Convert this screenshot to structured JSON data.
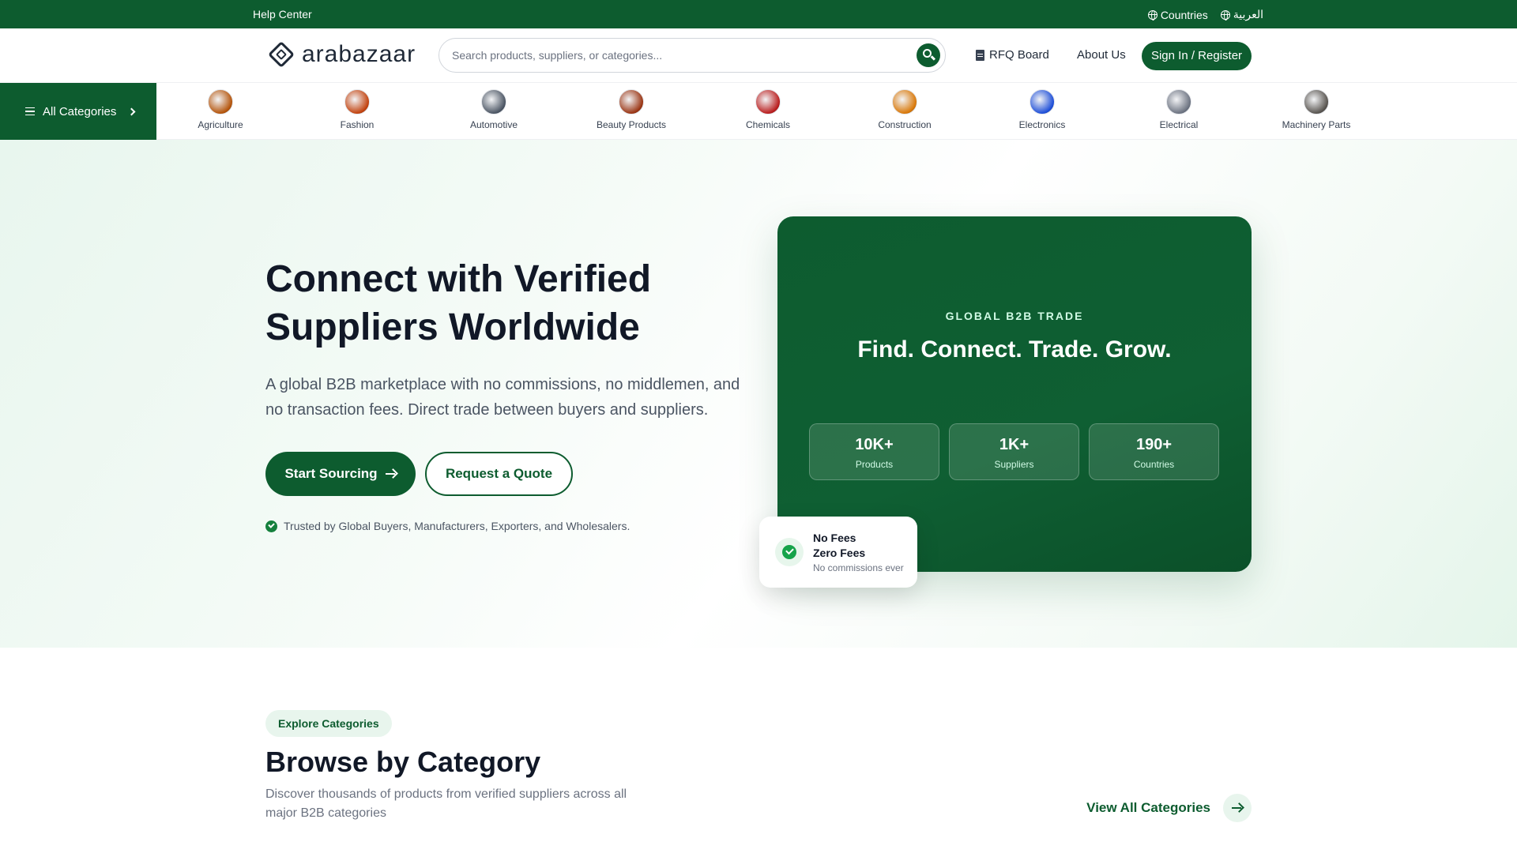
{
  "topbar": {
    "help_label": "Help Center",
    "countries_label": "Countries",
    "language_label": "العربية"
  },
  "header": {
    "logo_text": "arabazaar",
    "search": {
      "placeholder": "Search products, suppliers, or categories...",
      "value": ""
    },
    "rfq_label": "RFQ Board",
    "about_label": "About Us",
    "signin_label": "Sign In / Register"
  },
  "categories": {
    "all_label": "All Categories",
    "items": [
      {
        "label": "Agriculture",
        "color": "#b45309"
      },
      {
        "label": "Fashion",
        "color": "#c2410c"
      },
      {
        "label": "Automotive",
        "color": "#4b5563"
      },
      {
        "label": "Beauty Products",
        "color": "#9a3412"
      },
      {
        "label": "Chemicals",
        "color": "#b91c1c"
      },
      {
        "label": "Construction",
        "color": "#d97706"
      },
      {
        "label": "Electronics",
        "color": "#1d4ed8"
      },
      {
        "label": "Electrical",
        "color": "#6b7280"
      },
      {
        "label": "Machinery Parts",
        "color": "#57534e"
      }
    ]
  },
  "hero": {
    "title": "Connect with Verified Suppliers Worldwide",
    "subtitle": "A global B2B marketplace with no commissions, no middlemen, and no transaction fees. Direct trade between buyers and suppliers.",
    "primary_cta": "Start Sourcing",
    "secondary_cta": "Request a Quote",
    "trusted_text": "Trusted by Global Buyers, Manufacturers, Exporters, and Wholesalers."
  },
  "card": {
    "eyebrow": "GLOBAL B2B TRADE",
    "tagline": "Find. Connect. Trade. Grow.",
    "stats": [
      {
        "value": "10K+",
        "label": "Products"
      },
      {
        "value": "1K+",
        "label": "Suppliers"
      },
      {
        "value": "190+",
        "label": "Countries"
      }
    ]
  },
  "fees": {
    "line1": "No Fees",
    "line2": "Zero Fees",
    "line3": "No commissions ever"
  },
  "browse": {
    "pill": "Explore Categories",
    "title": "Browse by Category",
    "description": "Discover thousands of products from verified suppliers across all major B2B categories",
    "view_all": "View All Categories"
  },
  "colors": {
    "brand": "#0d5c2f",
    "accent_light": "#e8f5ed"
  }
}
